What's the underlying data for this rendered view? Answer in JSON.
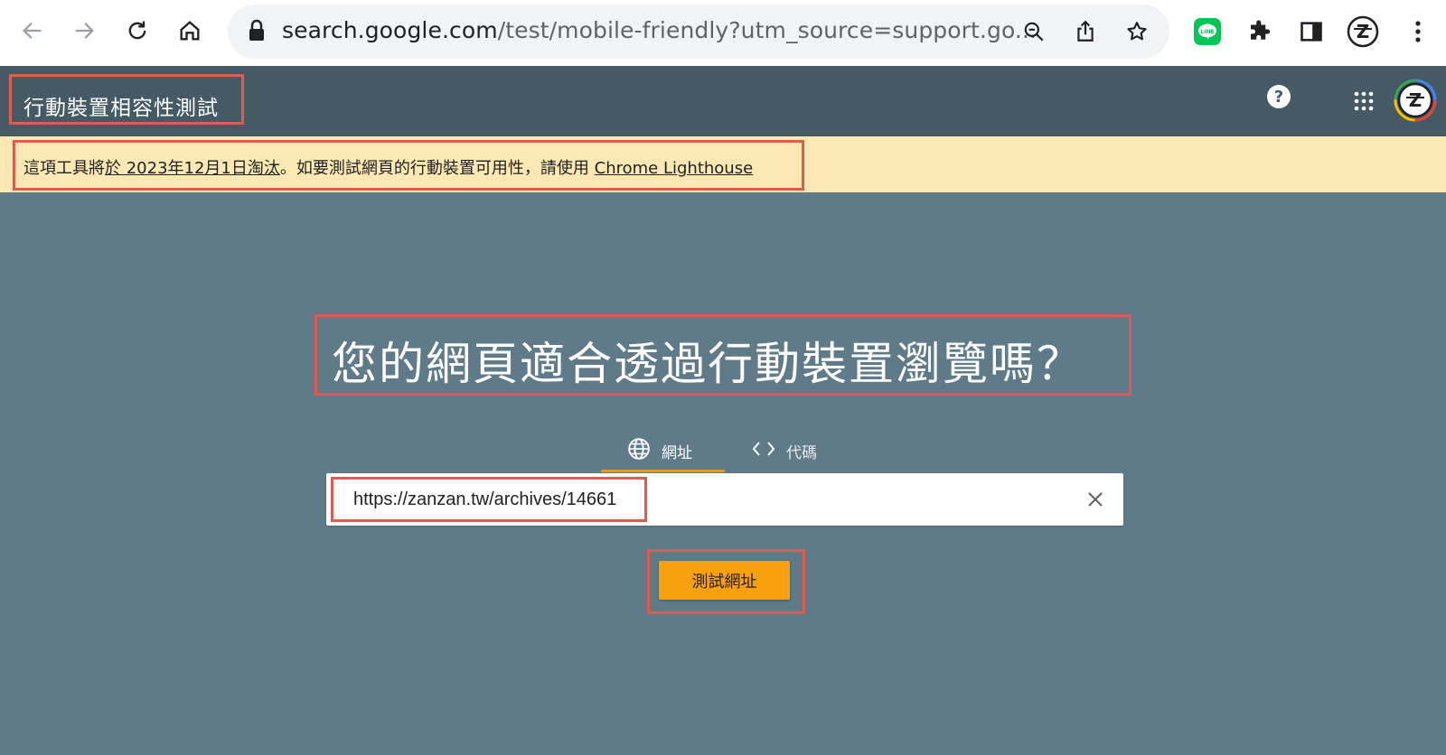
{
  "browser": {
    "url_host": "search.google.com",
    "url_rest": "/test/mobile-friendly?utm_source=support.go...",
    "icons": [
      "back-icon",
      "forward-icon",
      "reload-icon",
      "home-icon",
      "lock-icon",
      "zoom-icon",
      "share-icon",
      "bookmark-star-icon",
      "line-extension-icon",
      "extensions-puzzle-icon",
      "side-panel-icon",
      "profile-avatar-icon",
      "menu-kebab-icon"
    ]
  },
  "appbar": {
    "title": "行動裝置相容性測試",
    "help_symbol": "?"
  },
  "banner": {
    "prefix": "這項工具將",
    "date_link": "於 2023年12月1日淘汰",
    "middle": "。如要測試網頁的行動裝置可用性，請使用 ",
    "lighthouse_link": "Chrome Lighthouse"
  },
  "main": {
    "heading": "您的網頁適合透過行動裝置瀏覽嗎？",
    "tabs": [
      {
        "label": "網址",
        "icon": "globe-icon",
        "active": true
      },
      {
        "label": "代碼",
        "icon": "code-icon",
        "active": false
      }
    ],
    "url_input_value": "https://zanzan.tw/archives/14661",
    "test_button_label": "測試網址"
  },
  "colors": {
    "appbar": "#455a64",
    "body": "#5f7b8a",
    "banner": "#fce8b2",
    "accent": "#f9a00f",
    "highlight_box": "#e05a4e"
  }
}
